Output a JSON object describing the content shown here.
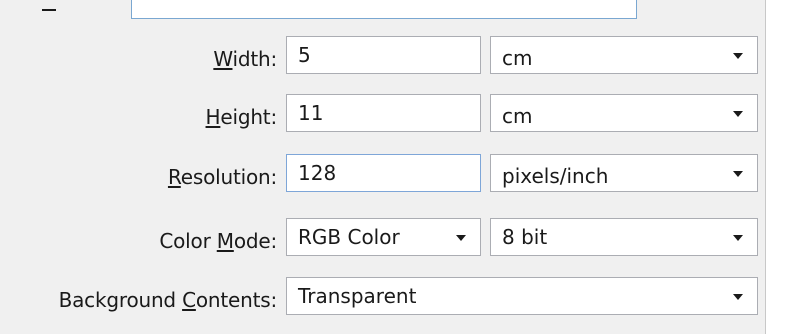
{
  "form": {
    "width": {
      "label_key": "W",
      "label_rest": "idth:",
      "value": "5",
      "unit": "cm"
    },
    "height": {
      "label_key": "H",
      "label_rest": "eight:",
      "value": "11",
      "unit": "cm"
    },
    "resolution": {
      "label_key": "R",
      "label_rest": "esolution:",
      "value": "128",
      "unit": "pixels/inch"
    },
    "color_mode": {
      "label_pre": "Color ",
      "label_key": "M",
      "label_rest": "ode:",
      "mode": "RGB Color",
      "depth": "8 bit"
    },
    "background": {
      "label_pre": "Background ",
      "label_key": "C",
      "label_rest": "ontents:",
      "value": "Transparent"
    }
  },
  "icons": {
    "dropdown": "chevron-down-icon"
  }
}
